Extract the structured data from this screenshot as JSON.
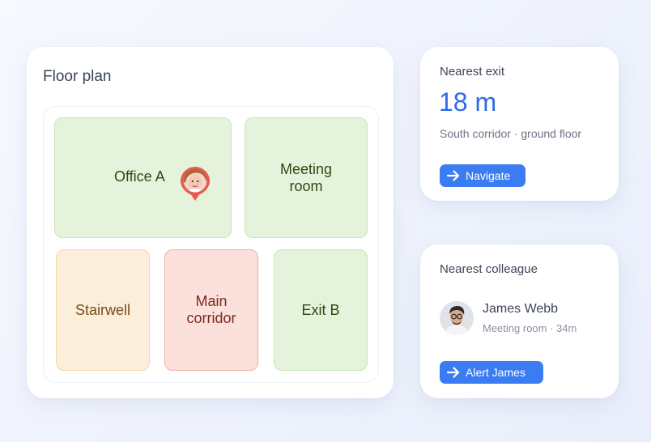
{
  "floor_plan": {
    "title": "Floor plan",
    "rooms": {
      "office": "Office A",
      "meeting_line1": "Meeting",
      "meeting_line2": "room",
      "stairwell": "Stairwell",
      "corridor_line1": "Main",
      "corridor_line2": "corridor",
      "exit_b": "Exit B"
    }
  },
  "nearest_exit": {
    "title": "Nearest exit",
    "distance": "18 m",
    "location": "South corridor · ground floor",
    "button": "Navigate"
  },
  "nearest_colleague": {
    "title": "Nearest colleague",
    "name": "James Webb",
    "meta": "Meeting room · 34m",
    "button": "Alert James"
  },
  "colors": {
    "accent": "#3b7cf2",
    "distance_text": "#2e6be6",
    "room_green": "#e6f3dc",
    "room_orange": "#fbeedb",
    "room_red": "#fbe0dc",
    "pin": "#e85a50"
  },
  "icons": [
    "location-pin-icon",
    "arrow-right-icon"
  ]
}
